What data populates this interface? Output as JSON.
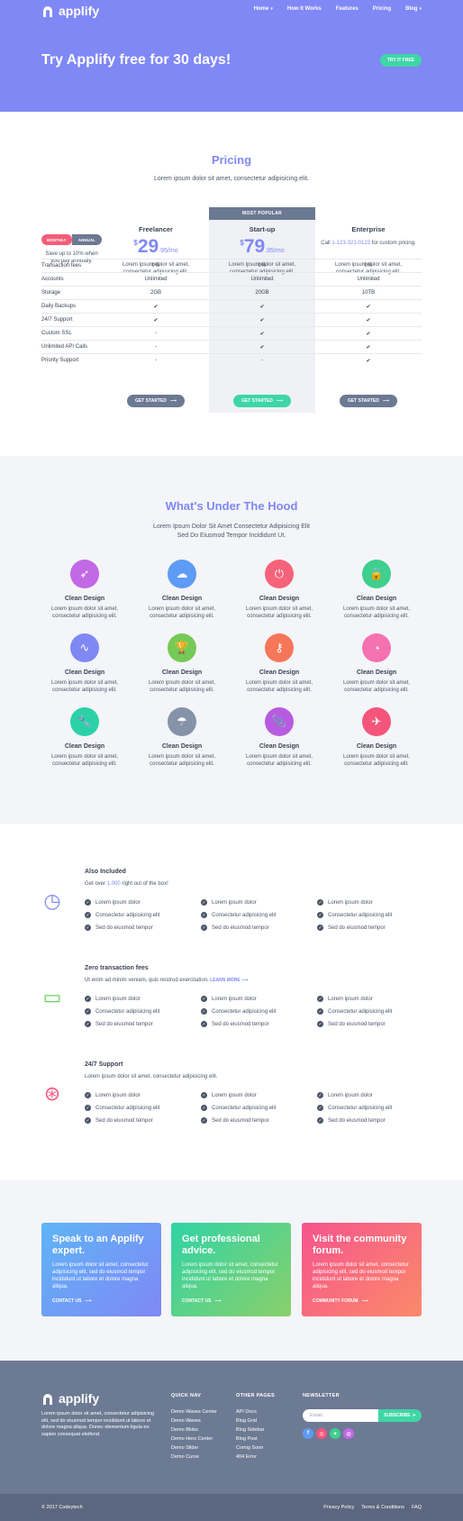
{
  "brand": "applify",
  "nav": {
    "items": [
      "Home",
      "How It Works",
      "Features",
      "Pricing",
      "Blog"
    ]
  },
  "hero": {
    "title": "Try Applify free for 30 days!",
    "cta": "TRY IT FREE"
  },
  "pricing": {
    "title": "Pricing",
    "subtitle": "Lorem ipsum dolor sit amet, consectetur adipisicing elit.",
    "most_popular": "MOST POPULAR",
    "toggle": {
      "monthly": "MONTHLY",
      "annual": "ANNUAL"
    },
    "save_note": "Save up to 10% when you pay annually.",
    "plans": [
      {
        "name": "Freelancer",
        "currency": "$",
        "price": "29",
        "cents": ".95/mo",
        "desc": "Lorem ipsum dolor sit amet, consectetur adipisicing elit."
      },
      {
        "name": "Start-up",
        "currency": "$",
        "price": "79",
        "cents": ".95/mo",
        "desc": "Lorem ipsum dolor sit amet, consectetur adipisicing elit."
      },
      {
        "name": "Enterprise",
        "call_pre": "Call ",
        "phone": "1-123-321-0123",
        "call_post": " for custom pricing.",
        "desc": "Lorem ipsum dolor sit amet, consectetur adipisicing elit."
      }
    ],
    "rows": [
      {
        "label": "Transaction fees",
        "values": [
          "0%",
          "0%",
          "0%"
        ]
      },
      {
        "label": "Accounts",
        "values": [
          "Unlimited",
          "Unlimited",
          "Unlimited"
        ]
      },
      {
        "label": "Storage",
        "values": [
          "2GB",
          "20GB",
          "10TB"
        ]
      },
      {
        "label": "Daily Backups",
        "values": [
          "✔",
          "✔",
          "✔"
        ]
      },
      {
        "label": "24/7 Support",
        "values": [
          "✔",
          "✔",
          "✔"
        ]
      },
      {
        "label": "Custom SSL",
        "values": [
          "-",
          "✔",
          "✔"
        ]
      },
      {
        "label": "Unlimited API Calls",
        "values": [
          "-",
          "✔",
          "✔"
        ]
      },
      {
        "label": "Priority Support",
        "values": [
          "-",
          "-",
          "✔"
        ]
      }
    ],
    "cta": "GET STARTED"
  },
  "features": {
    "title": "What's Under The Hood",
    "subtitle_1": "Lorem Ipsum Dolor Sit Amet Consectetur Adipisicing Elit",
    "subtitle_2": "Sed Do Eiusmod Tempor Incididunt Ut.",
    "item_title": "Clean Design",
    "item_desc": "Lorem ipsum dolor sit amet, consectetur adipisicing elit.",
    "icons": [
      {
        "name": "rocket-icon",
        "glyph": "➶",
        "color": "#c269e6"
      },
      {
        "name": "ghost-icon",
        "glyph": "☁",
        "color": "#5d9bf5"
      },
      {
        "name": "power-icon",
        "glyph": "⏻",
        "color": "#f5637a"
      },
      {
        "name": "lock-icon",
        "glyph": "🔒",
        "color": "#3fcf8e"
      },
      {
        "name": "chart-icon",
        "glyph": "∿",
        "color": "#7f88f5"
      },
      {
        "name": "trophy-icon",
        "glyph": "🏆",
        "color": "#75c957"
      },
      {
        "name": "key-icon",
        "glyph": "⚷",
        "color": "#f57658"
      },
      {
        "name": "gauge-icon",
        "glyph": "◔",
        "color": "#f472b0"
      },
      {
        "name": "wrench-icon",
        "glyph": "🔧",
        "color": "#2cd1a8"
      },
      {
        "name": "umbrella-icon",
        "glyph": "☂",
        "color": "#8592a8"
      },
      {
        "name": "paperclip-icon",
        "glyph": "📎",
        "color": "#b75ce0"
      },
      {
        "name": "paper-plane-icon",
        "glyph": "✈",
        "color": "#f5557a"
      }
    ]
  },
  "included": [
    {
      "title": "Also Included",
      "sub_pre": "Get over ",
      "sub_hl": "1,000",
      "sub_post": " right out of the box!",
      "icon": "speedometer-icon",
      "glyph": "◷",
      "color": "#7f88f5"
    },
    {
      "title": "Zero transaction fees",
      "sub_pre": "Ut enim ad minim veniam, quis nostrud exercitation.",
      "sub_link": "LEARN MORE",
      "icon": "wallet-icon",
      "glyph": "▭",
      "color": "#6ad45a"
    },
    {
      "title": "24/7 Support",
      "sub_pre": "Lorem ipsum dolor sit amet, consectetur adipisicing elit.",
      "icon": "lifebuoy-icon",
      "glyph": "⊛",
      "color": "#f5557a"
    }
  ],
  "included_items": [
    "Lorem ipsum dolor",
    "Consectetur adipisicing elit",
    "Sed do eiusmod tempor"
  ],
  "cta_cards": [
    {
      "title": "Speak to an Applify expert.",
      "text": "Lorem ipsum dolor sit amet, consectetur adipisicing elit, sed do eiusmod tempor incididunt ut labore et dolore magna aliqua.",
      "link": "CONTACT US"
    },
    {
      "title": "Get professional advice.",
      "text": "Lorem ipsum dolor sit amet, consectetur adipisicing elit, sed do eiusmod tempor incididunt ut labore et dolore magna aliqua.",
      "link": "CONTACT US"
    },
    {
      "title": "Visit the community forum.",
      "text": "Lorem ipsum dolor sit amet, consectetur adipisicing elit, sed do eiusmod tempor incididunt ut labore et dolore magna aliqua.",
      "link": "COMMUNITY FORUM"
    }
  ],
  "footer": {
    "about": "Lorem ipsum dolor sit amet, consectetur adipisicing elit, sed do eiusmod tempor incididunt ut labore et dolore magna aliqua. Donec elementum ligula eu sapien consequat eleifend.",
    "quick_nav_title": "QUICK NAV",
    "quick_nav": [
      "Demo Waves Center",
      "Demo Waves",
      "Demo Blobs",
      "Demo Hero Center",
      "Demo Slider",
      "Demo Curve"
    ],
    "other_title": "OTHER PAGES",
    "other": [
      "API Docs",
      "Blog Grid",
      "Blog Sidebar",
      "Blog Post",
      "Comig Soon",
      "404 Error"
    ],
    "newsletter_title": "NEWSLETTER",
    "email_placeholder": "Email",
    "subscribe": "SUBSCRIBE",
    "social": [
      {
        "name": "facebook-icon",
        "glyph": "f",
        "color": "#5d9bf5"
      },
      {
        "name": "instagram-icon",
        "glyph": "◎",
        "color": "#f5557a"
      },
      {
        "name": "twitter-icon",
        "glyph": "✦",
        "color": "#3fcf8e"
      },
      {
        "name": "dribbble-icon",
        "glyph": "◍",
        "color": "#c269e6"
      }
    ],
    "copyright": "© 2017 Codeytech",
    "legal": [
      "Privacy Policy",
      "Terms & Conditions",
      "FAQ"
    ]
  }
}
